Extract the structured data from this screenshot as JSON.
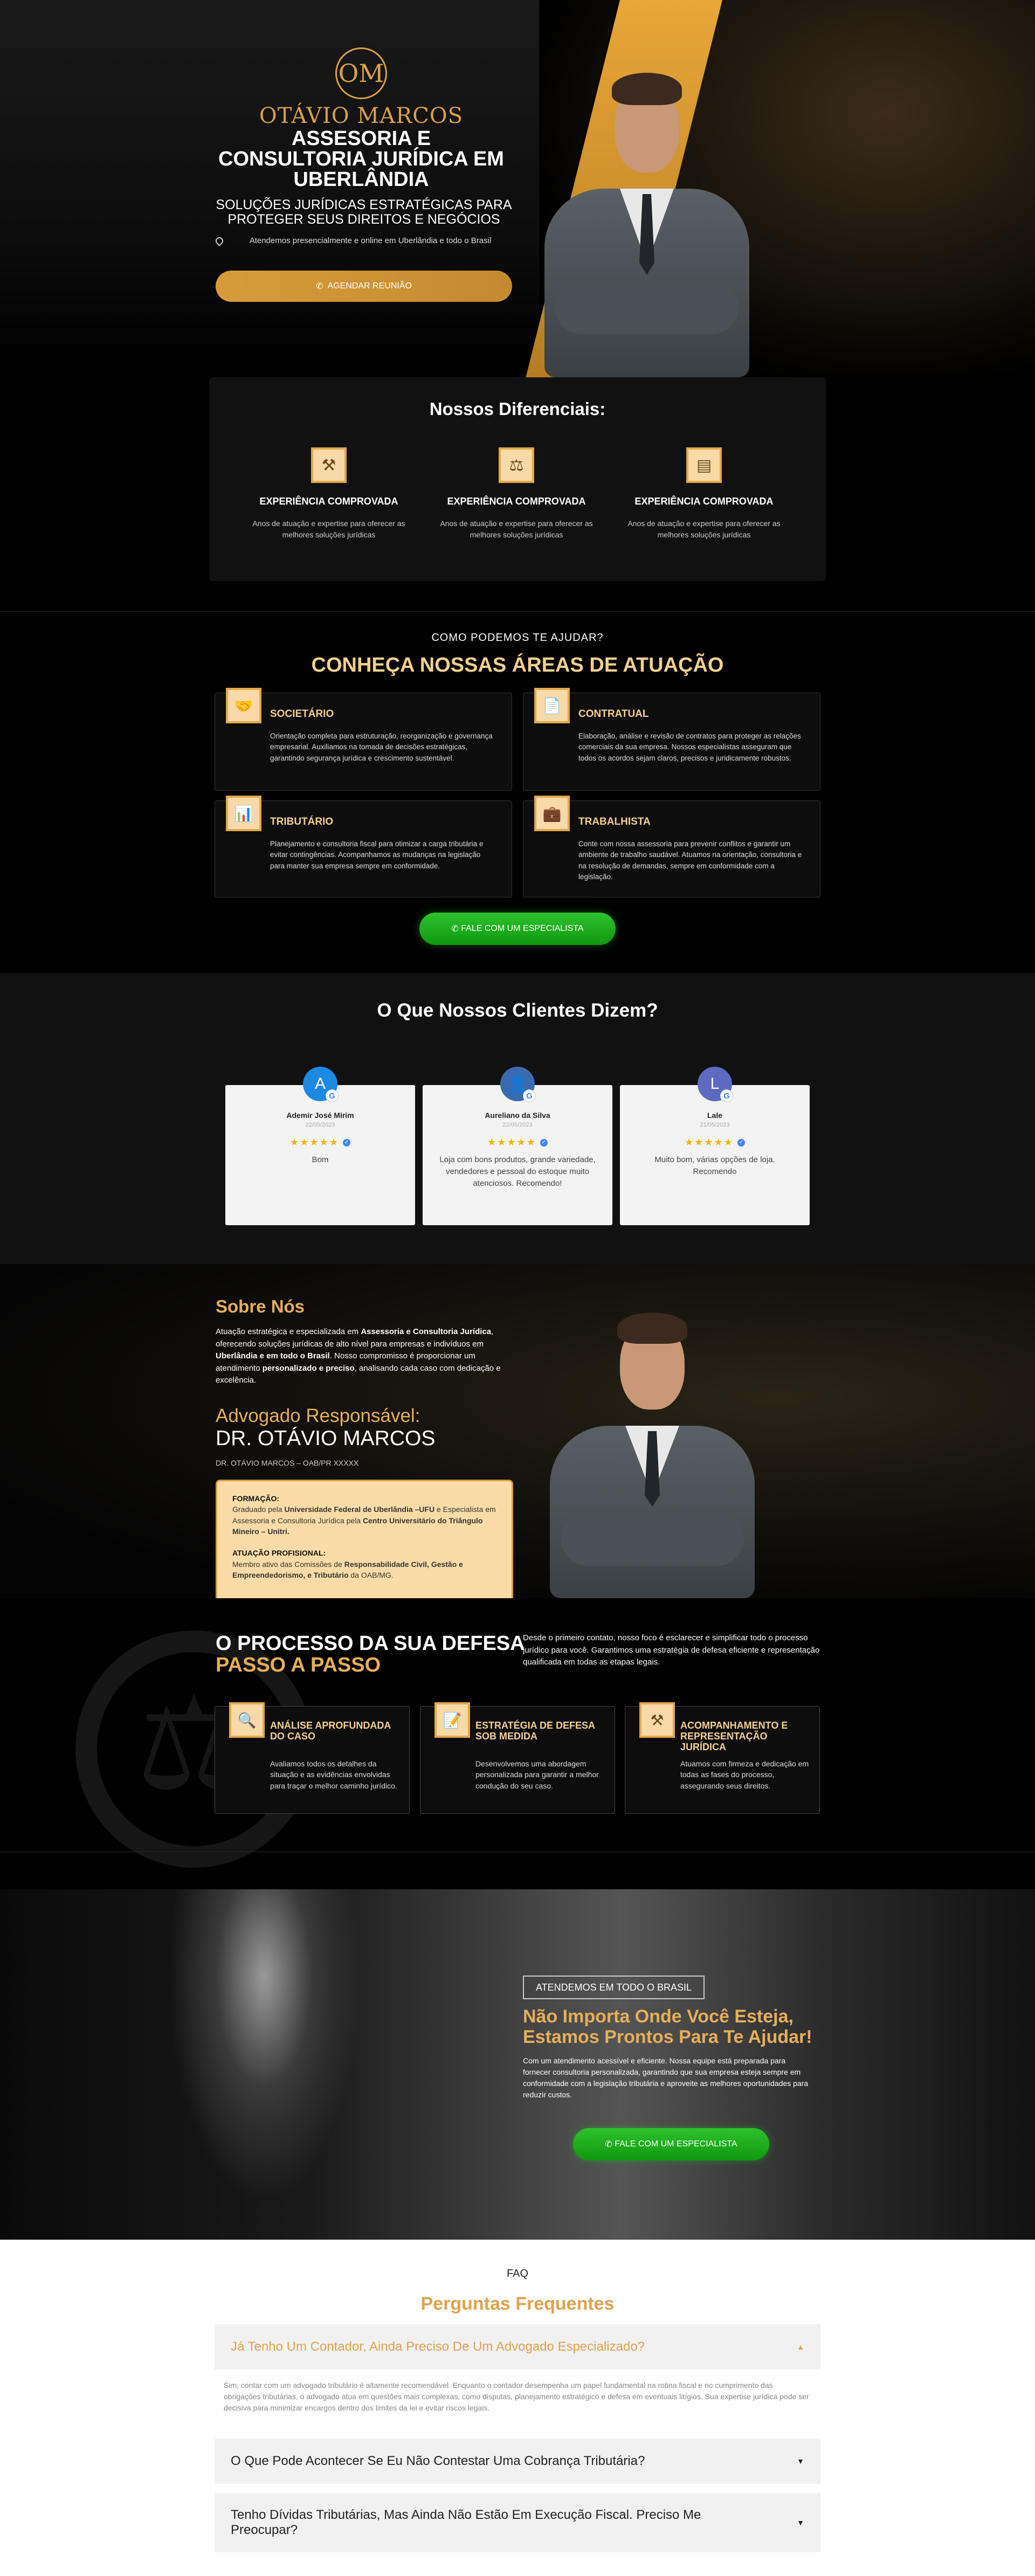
{
  "hero": {
    "logo_letters": "OM",
    "logo_name": "OTÁVIO MARCOS",
    "title": "ASSESORIA E CONSULTORIA JURÍDICA EM UBERLÂNDIA",
    "subtitle": "SOLUÇÕES JURÍDICAS ESTRATÉGICAS PARA PROTEGER SEUS DIREITOS E NEGÓCIOS",
    "location": "Atendemos presencialmente e online em Uberlândia e todo o Brasil",
    "cta": "AGENDAR REUNIÃO"
  },
  "differentials": {
    "title": "Nossos Diferenciais:",
    "items": [
      {
        "icon": "gavel-icon",
        "title": "EXPERIÊNCIA COMPROVADA",
        "text": "Anos de atuação e expertise para oferecer as melhores soluções jurídicas"
      },
      {
        "icon": "scales-icon",
        "title": "EXPERIÊNCIA COMPROVADA",
        "text": "Anos de atuação e expertise para oferecer as melhores soluções jurídicas"
      },
      {
        "icon": "certificate-icon",
        "title": "EXPERIÊNCIA COMPROVADA",
        "text": "Anos de atuação e expertise para oferecer as melhores soluções jurídicas"
      }
    ]
  },
  "areas": {
    "pre": "COMO PODEMOS TE AJUDAR?",
    "title": "CONHEÇA NOSSAS ÁREAS DE ATUAÇÃO",
    "cards": [
      {
        "icon": "handshake-icon",
        "title": "SOCIETÁRIO",
        "text": "Orientação completa para estruturação, reorganização e governança empresarial. Auxiliamos na tomada de decisões estratégicas, garantindo segurança jurídica e crescimento sustentável."
      },
      {
        "icon": "contract-icon",
        "title": "CONTRATUAL",
        "text": "Elaboração, análise e revisão de contratos para proteger as relações comerciais da sua empresa. Nossos especialistas asseguram que todos os acordos sejam claros, precisos e juridicamente robustos."
      },
      {
        "icon": "tax-chart-icon",
        "title": "TRIBUTÁRIO",
        "text": "Planejamento e consultoria fiscal para otimizar a carga tributária e evitar contingências. Acompanhamos as mudanças na legislação para manter sua empresa sempre em conformidade."
      },
      {
        "icon": "briefcase-icon",
        "title": "TRABALHISTA",
        "text": "Conte com nossa assessoria para prevenir conflitos e garantir um ambiente de trabalho saudável. Atuamos na orientação, consultoria e na resolução de demandas, sempre em conformidade com a legislação."
      }
    ],
    "cta": "FALE COM UM ESPECIALISTA"
  },
  "reviews": {
    "title": "O Que Nossos Clientes Dizem?",
    "items": [
      {
        "initial": "A",
        "avatar_color": "#1e88e5",
        "name": "Ademir José Mirim",
        "date": "22/05/2023",
        "stars": "★★★★★",
        "text": "Bom"
      },
      {
        "initial": "👤",
        "avatar_color": "#3a6bb0",
        "name": "Aureliano da Silva",
        "date": "22/05/2023",
        "stars": "★★★★★",
        "text": "Loja com bons produtos, grande variedade, vendedores e pessoal do estoque muito atenciosos. Recomendo!"
      },
      {
        "initial": "L",
        "avatar_color": "#5c6bc0",
        "name": "Lale",
        "date": "21/05/2023",
        "stars": "★★★★★",
        "text": "Muito bom, várias opções de loja. Recomendo"
      }
    ],
    "google_letter": "G",
    "verified": "✓"
  },
  "about": {
    "heading": "Sobre Nós",
    "p_1": "Atuação estratégica e especializada em ",
    "p_b1": "Assessoria e Consultoria Jurídica",
    "p_2": ", oferecendo soluções jurídicas de alto nível para empresas e indivíduos em ",
    "p_b2": "Uberlândia  e em todo o Brasil",
    "p_3": ". Nosso compromisso é proporcionar um atendimento ",
    "p_b3": "personalizado e preciso",
    "p_4": ", analisando cada caso com dedicação e excelência.",
    "lawyer_label": "Advogado Responsável:",
    "lawyer_name": "DR. OTÁVIO MARCOS",
    "oab": "DR. OTÁVIO MARCOS – OAB/PR XXXXX",
    "formation_label": "FORMAÇÃO:",
    "f_1": "Graduado pela ",
    "f_b1": "Universidade Federal de Uberlândia –UFU",
    "f_2": " e Especialista em Assessoria e Consultoria Jurídica pela ",
    "f_b2": "Centro Universitário do Triângulo Mineiro – Unitri.",
    "acting_label": "ATUAÇÃO PROFISIONAL:",
    "a_1": "Membro ativo das Comissões de ",
    "a_b1": "Responsabilidade Civil, Gestão e Empreendedorismo, e Tributário",
    "a_2": " da OAB/MG."
  },
  "process": {
    "title_1": "O PROCESSO DA SUA DEFESA",
    "title_2": "PASSO A PASSO",
    "intro": "Desde o primeiro contato, nosso foco é esclarecer e simplificar todo o processo jurídico para você. Garantimos uma estratégia de defesa eficiente e representação qualificada em todas as etapas legais.",
    "cards": [
      {
        "icon": "magnifier-gavel-icon",
        "title": "ANÁLISE APROFUNDADA DO CASO",
        "text": "Avaliamos todos os detalhes da situação e as evidências envolvidas para traçar o melhor caminho jurídico."
      },
      {
        "icon": "strategy-doc-icon",
        "title": "ESTRATÉGIA DE DEFESA SOB MEDIDA",
        "text": "Desenvolvemos uma abordagem personalizada para garantir a melhor condução do seu caso."
      },
      {
        "icon": "gavel-icon",
        "title": "ACOMPANHAMENTO E REPRESENTAÇÃO JURÍDICA",
        "text": "Atuamos com firmeza e dedicação em todas as fases do processo, assegurando seus direitos."
      }
    ]
  },
  "brazil": {
    "badge": "ATENDEMOS EM TODO O BRASIL",
    "title": "Não Importa Onde Você Esteja, Estamos Prontos Para Te Ajudar!",
    "text": "Com um atendimento acessível e eficiente. Nossa equipe está preparada para fornecer consultoria personalizada, garantindo que sua empresa esteja sempre em conformidade com a legislação tributária e aproveite as melhores oportunidades para reduzir custos.",
    "cta": "FALE COM UM ESPECIALISTA"
  },
  "faq": {
    "pre": "FAQ",
    "title": "Perguntas Frequentes",
    "items": [
      {
        "q": "Já Tenho Um Contador, Ainda Preciso De Um Advogado Especializado?",
        "a": "Sim, contar com um advogado tributário é altamente recomendável. Enquanto o contador desempenha um papel fundamental na rotina fiscal e no cumprimento das obrigações tributárias, o advogado atua em questões mais complexas, como disputas, planejamento estratégico e defesa em eventuais litígios. Sua expertise jurídica pode ser decisiva para minimizar encargos dentro dos limites da lei e evitar riscos legais."
      },
      {
        "q": "O Que Pode Acontecer Se Eu Não Contestar Uma Cobrança Tributária?"
      },
      {
        "q": "Tenho Dívidas Tributárias, Mas Ainda Não Estão Em Execução Fiscal. Preciso Me Preocupar?"
      }
    ]
  },
  "colors": {
    "gold": "#e6ae5a",
    "green": "#1aab1a",
    "cream": "#fbdca8"
  }
}
